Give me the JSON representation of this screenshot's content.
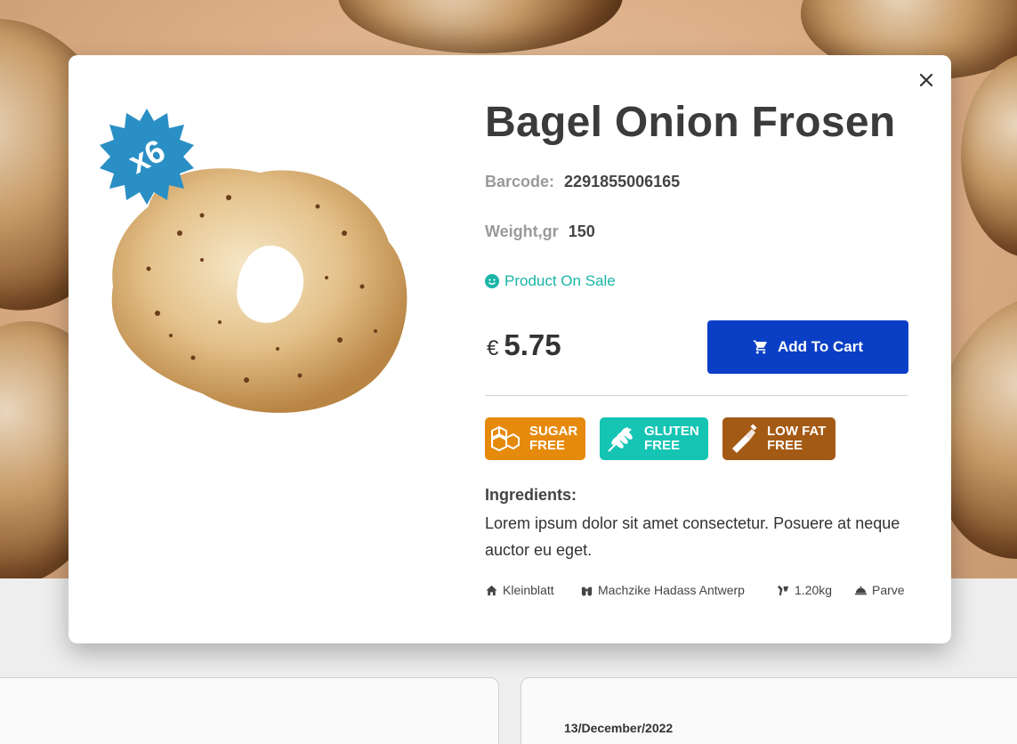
{
  "modal": {
    "title": "Bagel Onion Frosen",
    "barcode_label": "Barcode:",
    "barcode_value": "2291855006165",
    "weight_label": "Weight,gr",
    "weight_value": "150",
    "sale_text": "Product On Sale",
    "pack_badge": "x6",
    "currency": "€",
    "price": "5.75",
    "add_to_cart_label": "Add To Cart",
    "tags": [
      {
        "line1": "SUGAR",
        "line2": "FREE",
        "color": "#e58a0c",
        "icon": "sugar-cubes-icon"
      },
      {
        "line1": "GLUTEN",
        "line2": "FREE",
        "color": "#16c4b4",
        "icon": "wheat-icon"
      },
      {
        "line1": "LOW FAT",
        "line2": "FREE",
        "color": "#a35a14",
        "icon": "bottle-icon"
      }
    ],
    "ingredients_title": "Ingredients:",
    "ingredients_text": "Lorem ipsum dolor sit amet consectetur. Posuere at neque auctor eu eget.",
    "meta": [
      {
        "icon": "home-icon",
        "text": "Kleinblatt"
      },
      {
        "icon": "binoculars-icon",
        "text": "Machzike Hadass Antwerp"
      },
      {
        "icon": "scale-icon",
        "text": "1.20kg"
      },
      {
        "icon": "cloche-icon",
        "text": "Parve"
      }
    ]
  },
  "background_card": {
    "date": "13/December/2022"
  },
  "colors": {
    "accent": "#0a3fc5",
    "sale": "#19b5a7"
  }
}
